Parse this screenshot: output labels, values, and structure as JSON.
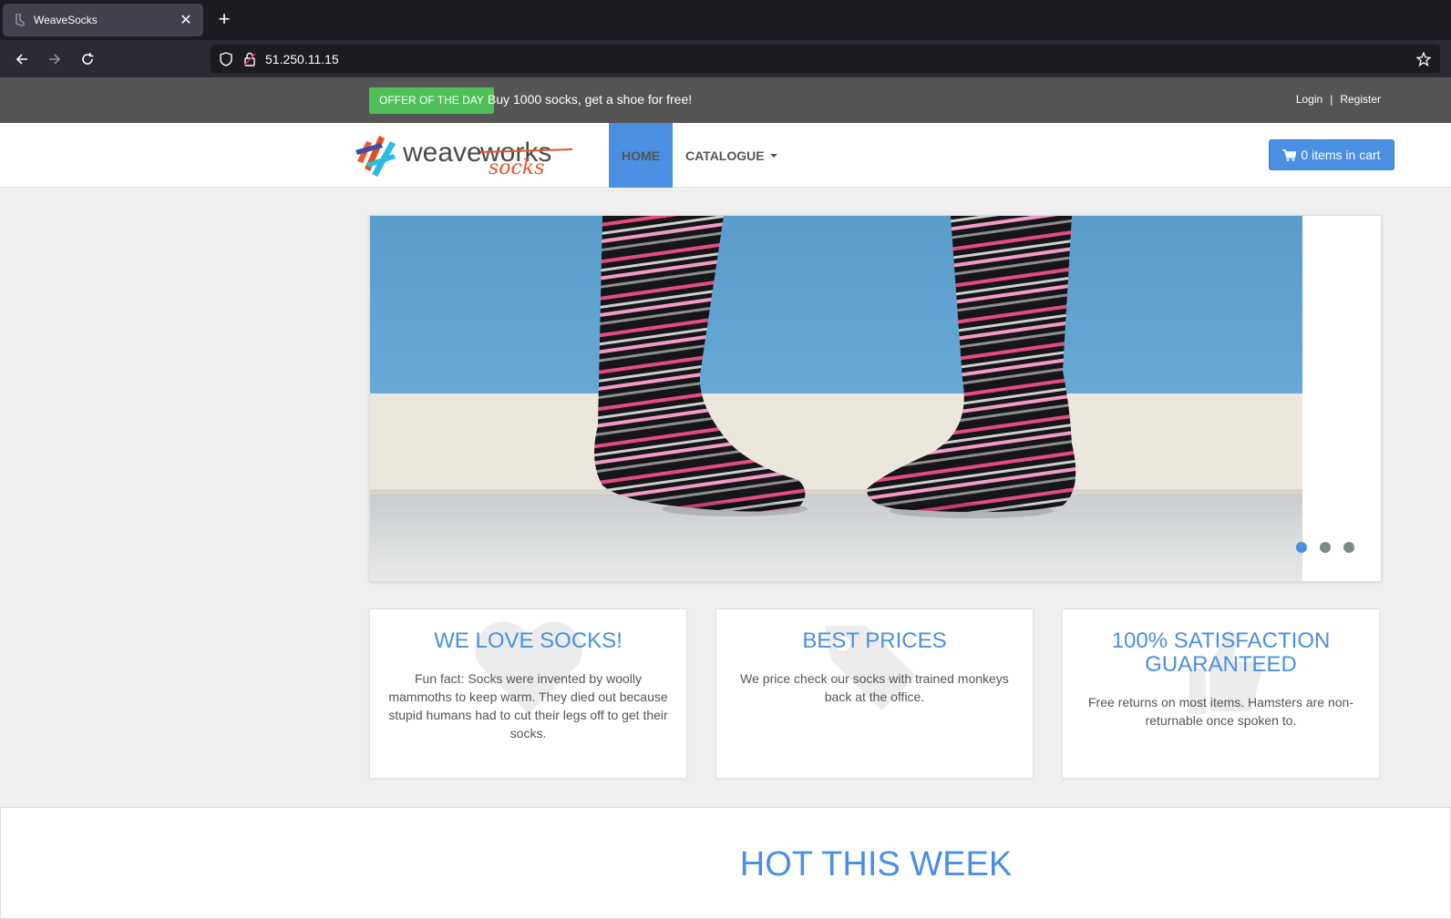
{
  "browser": {
    "tab_title": "WeaveSocks",
    "url": "51.250.11.15"
  },
  "topbar": {
    "offer_badge": "OFFER OF THE DAY",
    "offer_text": "Buy 1000 socks, get a shoe for free!",
    "login": "Login",
    "separator": "|",
    "register": "Register"
  },
  "header": {
    "logo_word": "weave",
    "logo_strike": "works",
    "logo_sub": "socks",
    "nav_home": "HOME",
    "nav_catalogue": "CATALOGUE",
    "cart_label": "0 items in cart"
  },
  "carousel": {
    "slide_count": 3,
    "active_slide": 1
  },
  "features": [
    {
      "title": "WE LOVE SOCKS!",
      "text": "Fun fact: Socks were invented by woolly mammoths to keep warm. They died out because stupid humans had to cut their legs off to get their socks.",
      "icon": "heart-icon"
    },
    {
      "title": "BEST PRICES",
      "text": "We price check our socks with trained monkeys back at the office.",
      "icon": "tags-icon"
    },
    {
      "title": "100% SATISFACTION GUARANTEED",
      "text": "Free returns on most items. Hamsters are non-returnable once spoken to.",
      "icon": "thumbs-up-icon"
    }
  ],
  "hot_section": {
    "title": "HOT THIS WEEK"
  },
  "colors": {
    "accent": "#4a8fe2",
    "offer_green": "#4fbf5a",
    "topbar_bg": "#555555",
    "page_bg": "#efefef"
  }
}
